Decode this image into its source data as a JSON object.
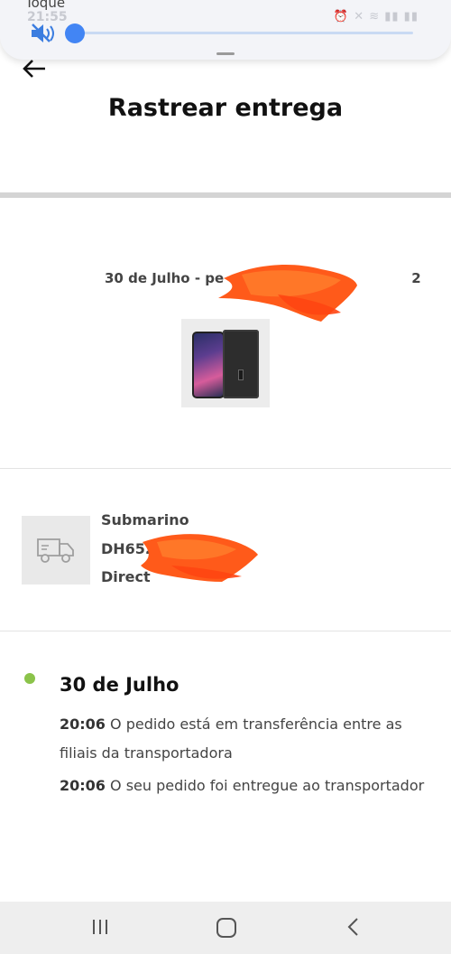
{
  "overlay": {
    "label": "Toque",
    "time": "21:55",
    "volume_fraction": 0.0,
    "status_icons": "⏰ ✕ ≋ ▮▮ ▮▮"
  },
  "header": {
    "title": "Rastrear entrega"
  },
  "order": {
    "date_line": "30 de Julho - pe",
    "date_line_tail": "2"
  },
  "carrier": {
    "name": "Submarino",
    "code_prefix": "DH652",
    "method": "Direct"
  },
  "tracking": {
    "day": "30 de Julho",
    "events": [
      {
        "time": "20:06",
        "text": "O pedido está em transferência entre as filiais da transportadora"
      },
      {
        "time": "20:06",
        "text": "O seu pedido foi entregue ao transportador"
      }
    ]
  },
  "nav": {
    "recents": "recents-icon",
    "home": "home-icon",
    "back": "back-icon"
  },
  "colors": {
    "status_dot": "#8bc34a",
    "slider": "#4285f4",
    "redaction": "#ff5a1a"
  }
}
